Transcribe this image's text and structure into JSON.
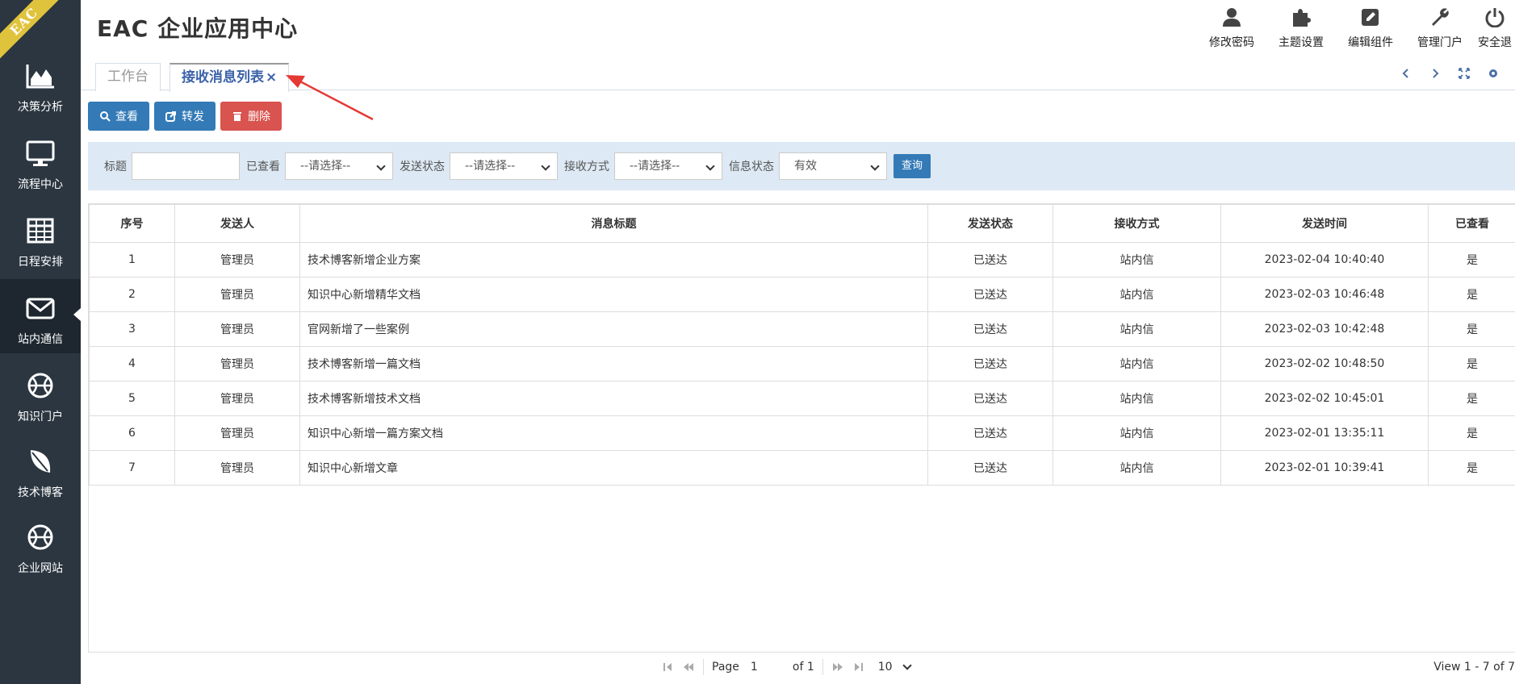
{
  "app": {
    "logo_text": "EAC",
    "title": "EAC 企业应用中心"
  },
  "sidebar": {
    "items": [
      {
        "label": "决策分析",
        "icon": "area-chart-icon"
      },
      {
        "label": "流程中心",
        "icon": "monitor-icon"
      },
      {
        "label": "日程安排",
        "icon": "calendar-grid-icon"
      },
      {
        "label": "站内通信",
        "icon": "envelope-icon",
        "active": true
      },
      {
        "label": "知识门户",
        "icon": "basketball-icon"
      },
      {
        "label": "技术博客",
        "icon": "leaf-icon"
      },
      {
        "label": "企业网站",
        "icon": "basketball-icon"
      }
    ]
  },
  "header": {
    "actions": [
      {
        "label": "修改密码",
        "icon": "user-icon"
      },
      {
        "label": "主题设置",
        "icon": "puzzle-icon"
      },
      {
        "label": "编辑组件",
        "icon": "edit-icon"
      },
      {
        "label": "管理门户",
        "icon": "wrench-icon"
      },
      {
        "label": "安全退",
        "icon": "power-icon"
      }
    ]
  },
  "tabs": [
    {
      "label": "工作台",
      "active": false
    },
    {
      "label": "接收消息列表",
      "close": "×",
      "active": true
    }
  ],
  "toolbar": {
    "view_label": "查看",
    "forward_label": "转发",
    "delete_label": "删除"
  },
  "filters": {
    "title_label": "标题",
    "title_value": "",
    "viewed_label": "已查看",
    "viewed_value": "--请选择--",
    "send_status_label": "发送状态",
    "send_status_value": "--请选择--",
    "receive_method_label": "接收方式",
    "receive_method_value": "--请选择--",
    "info_status_label": "信息状态",
    "info_status_value": "有效",
    "search_label": "查询"
  },
  "table": {
    "columns": [
      "序号",
      "发送人",
      "消息标题",
      "发送状态",
      "接收方式",
      "发送时间",
      "已查看"
    ],
    "rows": [
      [
        "1",
        "管理员",
        "技术博客新增企业方案",
        "已送达",
        "站内信",
        "2023-02-04 10:40:40",
        "是"
      ],
      [
        "2",
        "管理员",
        "知识中心新增精华文档",
        "已送达",
        "站内信",
        "2023-02-03 10:46:48",
        "是"
      ],
      [
        "3",
        "管理员",
        "官网新增了一些案例",
        "已送达",
        "站内信",
        "2023-02-03 10:42:48",
        "是"
      ],
      [
        "4",
        "管理员",
        "技术博客新增一篇文档",
        "已送达",
        "站内信",
        "2023-02-02 10:48:50",
        "是"
      ],
      [
        "5",
        "管理员",
        "技术博客新增技术文档",
        "已送达",
        "站内信",
        "2023-02-02 10:45:01",
        "是"
      ],
      [
        "6",
        "管理员",
        "知识中心新增一篇方案文档",
        "已送达",
        "站内信",
        "2023-02-01 13:35:11",
        "是"
      ],
      [
        "7",
        "管理员",
        "知识中心新增文章",
        "已送达",
        "站内信",
        "2023-02-01 10:39:41",
        "是"
      ]
    ]
  },
  "pager": {
    "page_label": "Page",
    "page_value": "1",
    "of_label": "of 1",
    "page_size": "10",
    "view_text": "View 1 - 7 of 7"
  },
  "colors": {
    "sidebar": "#2b3640",
    "primary": "#337ab7",
    "danger": "#d9534f",
    "filter_bg": "#dde9f4",
    "logo": "#e0c33c"
  }
}
